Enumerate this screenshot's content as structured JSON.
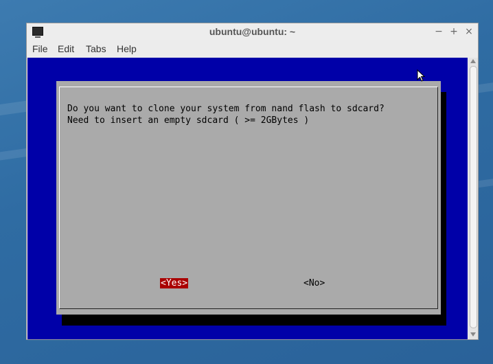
{
  "window": {
    "title": "ubuntu@ubuntu: ~",
    "controls": {
      "minimize": "−",
      "maximize": "+",
      "close": "×"
    }
  },
  "menu": [
    "File",
    "Edit",
    "Tabs",
    "Help"
  ],
  "dialog": {
    "line1": "Do you want to clone your system from nand flash to sdcard?",
    "line2": "Need to insert an empty sdcard ( >= 2GBytes )",
    "yes": "<Yes>",
    "no": "<No>"
  },
  "colors": {
    "terminal_bg": "#0000a8",
    "dialog_bg": "#aaaaaa",
    "selected_button_bg": "#aa0000"
  },
  "icons": [
    "terminal-icon",
    "mouse-pointer-icon"
  ]
}
